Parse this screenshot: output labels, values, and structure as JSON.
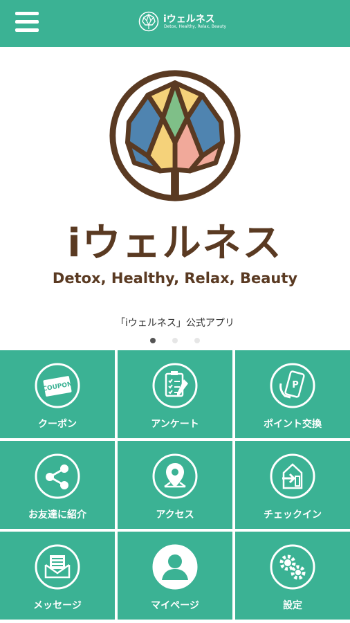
{
  "header": {
    "app_title": "iウェルネス",
    "app_subtitle": "Detox, Healthy, Relax, Beauty"
  },
  "hero": {
    "brand_name": "iウェルネス",
    "tagline": "Detox, Healthy, Relax, Beauty",
    "caption": "「iウェルネス」公式アプリ",
    "slide_count": 3,
    "active_slide": 1
  },
  "menu": {
    "items": [
      {
        "label": "クーポン",
        "icon": "coupon-icon"
      },
      {
        "label": "アンケート",
        "icon": "clipboard-icon"
      },
      {
        "label": "ポイント交換",
        "icon": "point-exchange-icon"
      },
      {
        "label": "お友達に紹介",
        "icon": "share-icon"
      },
      {
        "label": "アクセス",
        "icon": "map-pin-icon"
      },
      {
        "label": "チェックイン",
        "icon": "checkin-icon"
      },
      {
        "label": "メッセージ",
        "icon": "envelope-icon"
      },
      {
        "label": "マイページ",
        "icon": "user-icon"
      },
      {
        "label": "設定",
        "icon": "gears-icon"
      }
    ]
  },
  "colors": {
    "accent": "#3bb294",
    "brand_brown": "#5a3a22",
    "white": "#ffffff"
  }
}
